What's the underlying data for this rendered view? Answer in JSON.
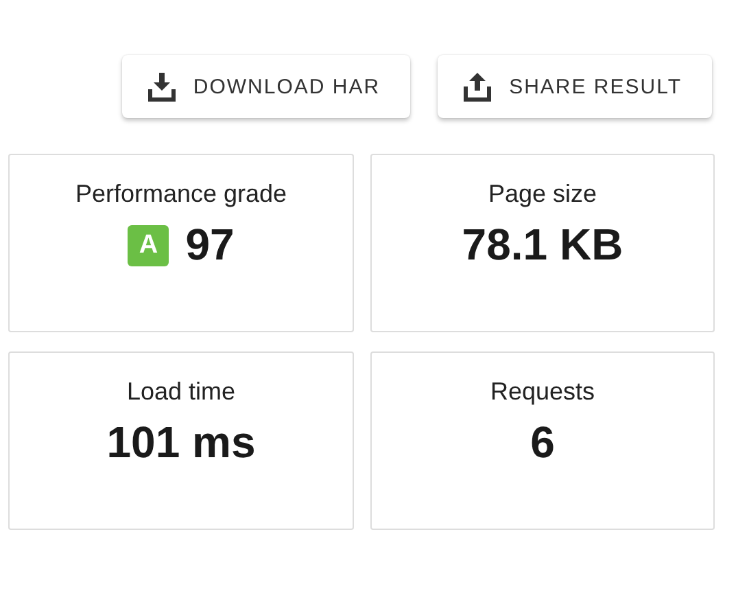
{
  "actions": [
    {
      "kind": "download",
      "label": "DOWNLOAD HAR"
    },
    {
      "kind": "share",
      "label": "SHARE RESULT"
    }
  ],
  "metrics": [
    {
      "label": "Performance grade",
      "value": "97",
      "grade": {
        "letter": "A",
        "color": "#6bbf45"
      }
    },
    {
      "label": "Page size",
      "value": "78.1 KB"
    },
    {
      "label": "Load time",
      "value": "101 ms"
    },
    {
      "label": "Requests",
      "value": "6"
    }
  ]
}
